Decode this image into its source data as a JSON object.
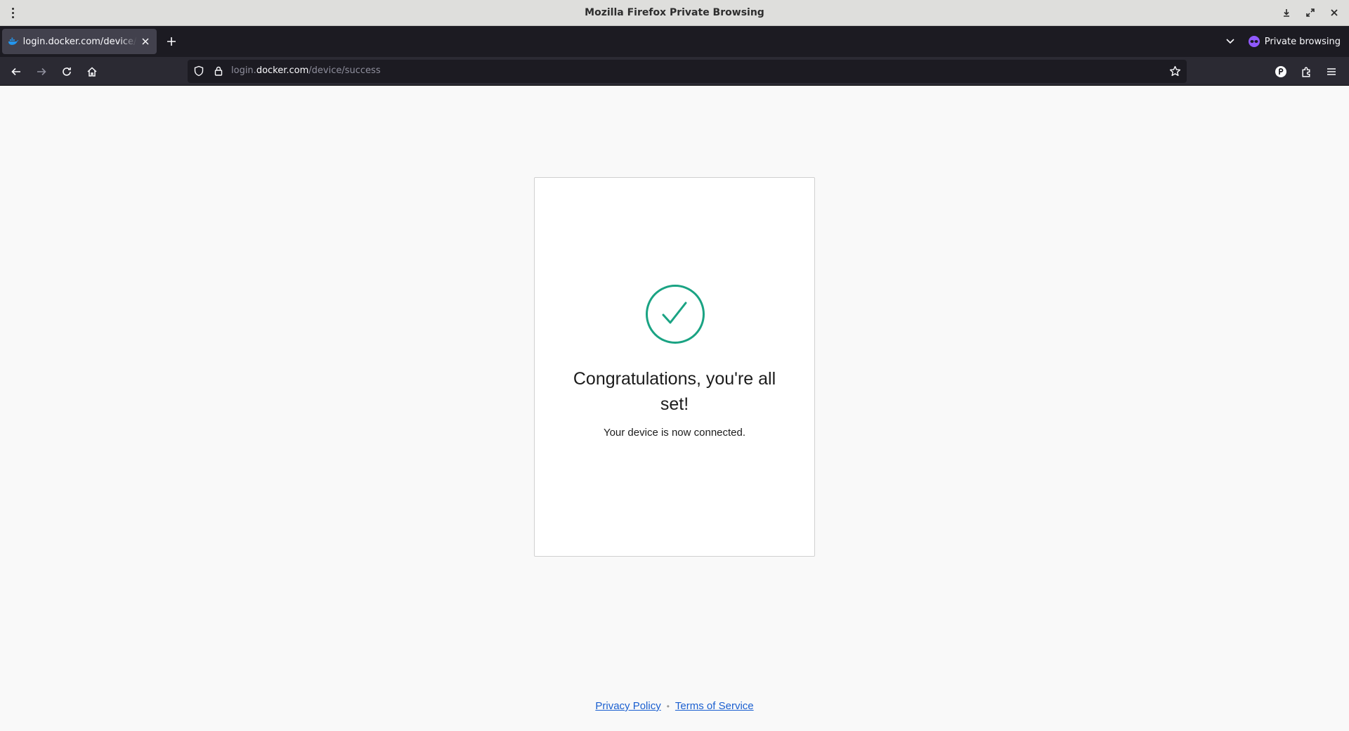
{
  "window": {
    "title": "Mozilla Firefox Private Browsing"
  },
  "tabs": [
    {
      "title": "login.docker.com/device/success",
      "active": true
    }
  ],
  "tabstrip": {
    "private_label": "Private browsing"
  },
  "urlbar": {
    "prefix": "login.",
    "domain": "docker.com",
    "path": "/device/success"
  },
  "card": {
    "heading": "Congratulations, you're all set!",
    "subtext": "Your device is now connected.",
    "accent_color": "#1aa383"
  },
  "footer": {
    "privacy_label": "Privacy Policy",
    "separator": "•",
    "terms_label": "Terms of Service"
  },
  "icons": {
    "titlebar": [
      "menu-dots-icon",
      "download-icon",
      "restore-icon",
      "close-icon"
    ],
    "nav": [
      "back-arrow-icon",
      "forward-arrow-icon",
      "reload-icon",
      "home-icon"
    ],
    "urlbar": [
      "shield-icon",
      "lock-icon",
      "star-icon"
    ],
    "toolbar": [
      "account-icon",
      "extensions-icon",
      "hamburger-menu-icon"
    ]
  }
}
